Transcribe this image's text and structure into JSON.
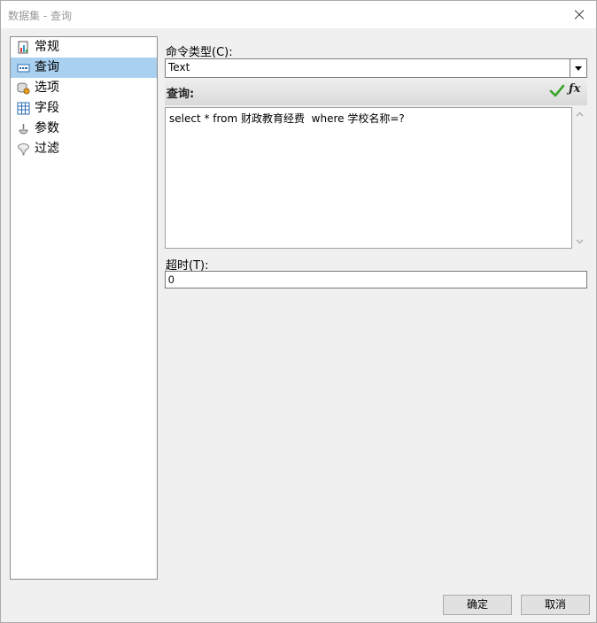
{
  "window": {
    "title": "数据集 - 查询"
  },
  "nav": {
    "items": [
      {
        "label": "常规",
        "icon": "general-icon"
      },
      {
        "label": "查询",
        "icon": "query-icon"
      },
      {
        "label": "选项",
        "icon": "options-icon"
      },
      {
        "label": "字段",
        "icon": "fields-icon"
      },
      {
        "label": "参数",
        "icon": "parameters-icon"
      },
      {
        "label": "过滤",
        "icon": "filter-icon"
      }
    ],
    "selected": "查询"
  },
  "form": {
    "command_type_label": "命令类型(C):",
    "command_type_value": "Text",
    "query_label": "查询:",
    "query_text": "select * from 财政教育经费  where 学校名称=?",
    "timeout_label": "超时(T):",
    "timeout_value": "0"
  },
  "buttons": {
    "ok": "确定",
    "cancel": "取消"
  },
  "colors": {
    "selected_bg": "#aad0f0",
    "check_green": "#3aa32a"
  }
}
